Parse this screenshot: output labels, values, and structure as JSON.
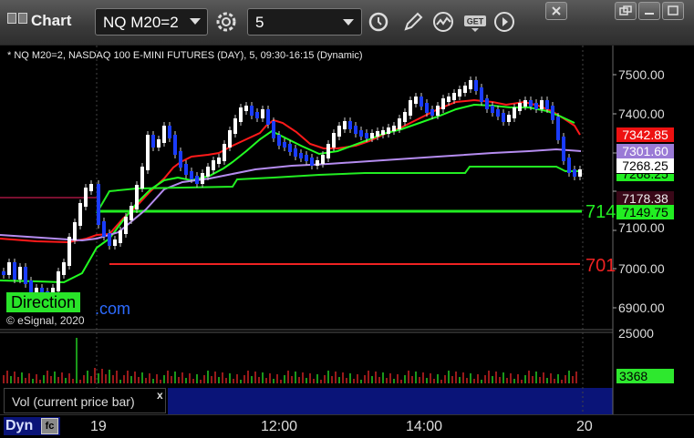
{
  "toolbar": {
    "app_title": "Chart",
    "symbol_value": "NQ M20=2",
    "interval_value": "5",
    "icons": [
      "gear-icon",
      "clock-icon",
      "pencil-icon",
      "indicator-icon",
      "get-icon",
      "play-icon",
      "restore-icon",
      "minimize-icon",
      "maximize-icon",
      "close-icon"
    ]
  },
  "chart": {
    "info": "* NQ M20=2, NASDAQ 100 E-MINI FUTURES (DAY), 5, 09:30-16:15 (Dynamic)",
    "direction_label": "Direction",
    "link_fragment": ".com",
    "copyright": "© eSignal, 2020",
    "line_tag_green": "714",
    "line_tag_red": "701",
    "price_axis": [
      "7500.00",
      "7400.00",
      "7300.00",
      "7200.00",
      "7100.00",
      "7000.00",
      "6900.00"
    ],
    "tags": {
      "red": "7342.85",
      "purple": "7301.60",
      "white": "7268.25",
      "green_hidden": "7268.25",
      "dark": "7178.38",
      "green": "7149.75"
    },
    "colors": {
      "up": "#ffffff",
      "down": "#1a3cff",
      "ma_red": "#ff1a1a",
      "ma_green": "#22ff22",
      "ma_purple": "#b58cf0",
      "level_green": "#22ee22",
      "level_red": "#ee2222"
    }
  },
  "volume": {
    "title": "Vol (current price bar)",
    "close_label": "x",
    "axis_label": "25000",
    "current": "3368"
  },
  "footer": {
    "dyn_label": "Dyn",
    "fc_label": "fc",
    "time_labels": [
      "19",
      "12:00",
      "14:00",
      "20"
    ]
  }
}
